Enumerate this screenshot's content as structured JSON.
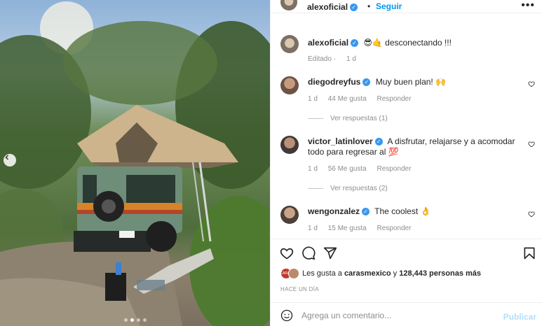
{
  "post": {
    "author": "alexoficial",
    "follow_label": "Seguir",
    "separator": "•",
    "more_label": "•••",
    "caption_emoji": "😎🤙",
    "caption_text": "desconectando !!!",
    "edited_label": "Editado",
    "edited_time": "1 d"
  },
  "comments": [
    {
      "user": "diegodreyfus",
      "text": "Muy buen plan! 🙌",
      "time": "1 d",
      "likes": "44 Me gusta",
      "reply": "Responder",
      "view_replies": "Ver respuestas (1)"
    },
    {
      "user": "victor_latinlover",
      "text": "A disfrutar, relajarse y a acomodar todo para regresar al 💯",
      "time": "1 d",
      "likes": "56 Me gusta",
      "reply": "Responder",
      "view_replies": "Ver respuestas (2)"
    },
    {
      "user": "wengonzalez",
      "text": "The coolest 👌",
      "time": "1 d",
      "likes": "15 Me gusta",
      "reply": "Responder"
    }
  ],
  "likes": {
    "prefix": "Les gusta a",
    "first_user": "carasmexico",
    "connector": "y",
    "others": "128,443 personas más",
    "badge_text": "CARAS"
  },
  "time_ago": "HACE UN DÍA",
  "add_comment": {
    "placeholder": "Agrega un comentario...",
    "post_label": "Publicar"
  },
  "icons": {
    "like": "heart-icon",
    "comment": "comment-icon",
    "share": "send-icon",
    "save": "bookmark-icon",
    "emoji": "smiley-icon",
    "carousel_prev": "chevron-left-icon",
    "verified": "verified-badge-icon"
  },
  "colors": {
    "accent": "#0095f6",
    "verified": "#3897f0",
    "muted": "#8e8e8e",
    "post_disabled": "#b2dffc"
  },
  "carousel": {
    "total_slides": 4,
    "active_index": 1
  }
}
